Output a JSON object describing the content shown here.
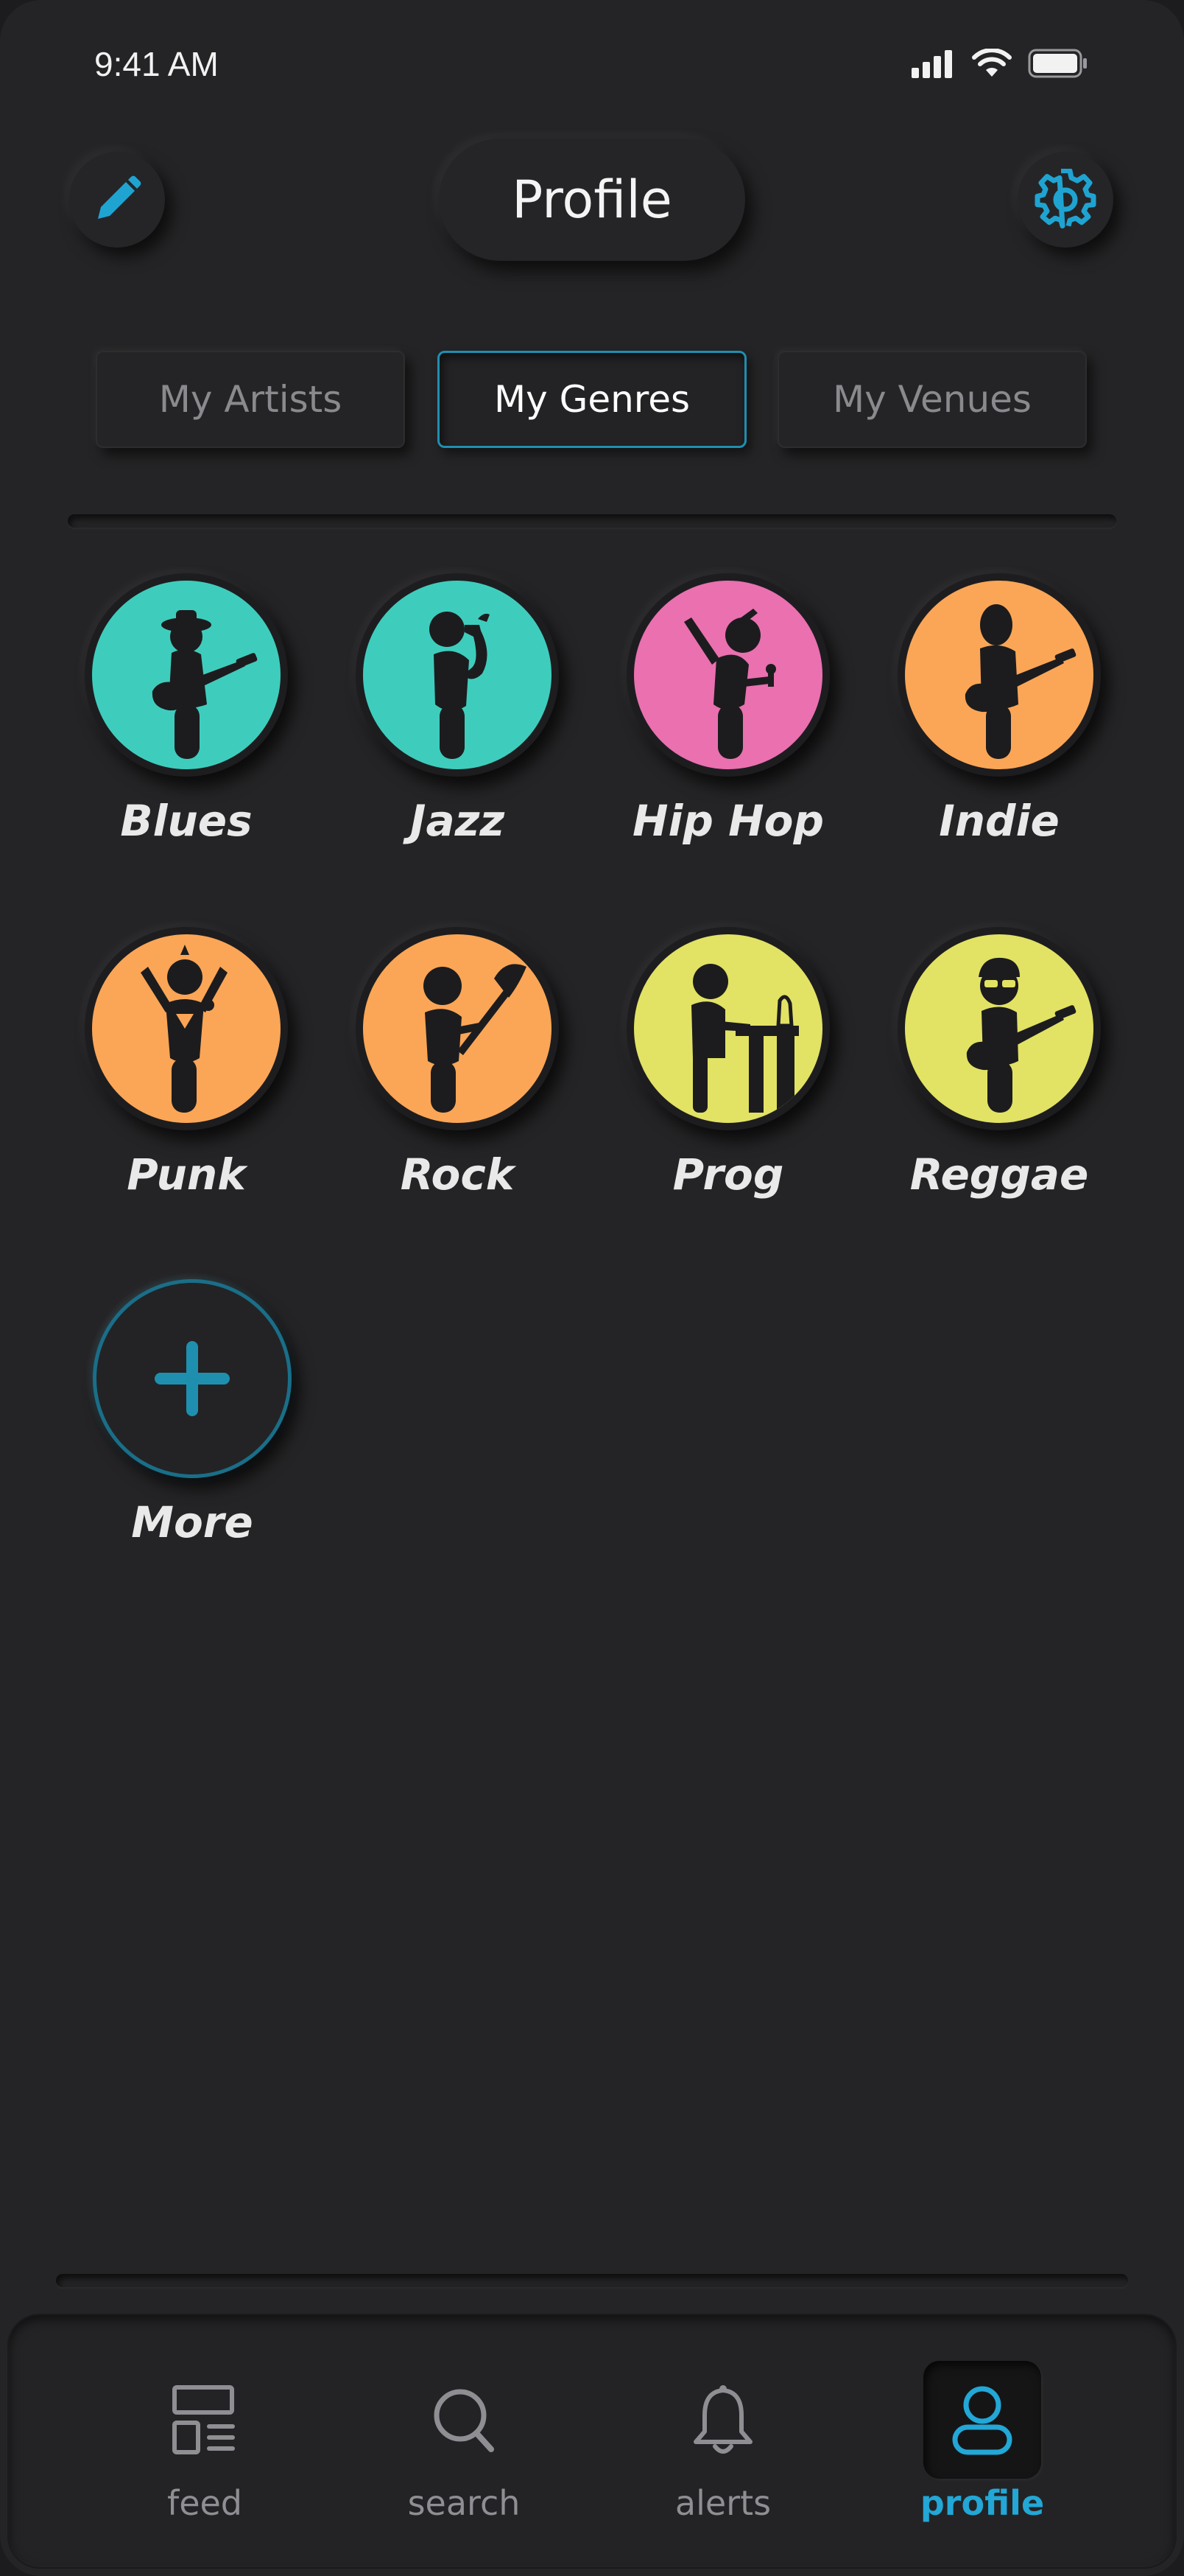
{
  "status_bar": {
    "time": "9:41 AM"
  },
  "header": {
    "title": "Profile",
    "edit_icon": "pencil-icon",
    "settings_icon": "gear-icon"
  },
  "tabs": [
    {
      "label": "My Artists",
      "active": false
    },
    {
      "label": "My Genres",
      "active": true
    },
    {
      "label": "My Venues",
      "active": false
    }
  ],
  "genres": [
    {
      "label": "Blues",
      "color": "#3ecdbd",
      "icon": "guitarist-hat-icon"
    },
    {
      "label": "Jazz",
      "color": "#3ecdbd",
      "icon": "saxophonist-icon"
    },
    {
      "label": "Hip Hop",
      "color": "#ea70b0",
      "icon": "rapper-icon"
    },
    {
      "label": "Indie",
      "color": "#fba656",
      "icon": "guitarist-icon"
    },
    {
      "label": "Punk",
      "color": "#fba656",
      "icon": "punk-singer-icon"
    },
    {
      "label": "Rock",
      "color": "#fba656",
      "icon": "rock-guitarist-icon"
    },
    {
      "label": "Prog",
      "color": "#e2e265",
      "icon": "keyboardist-icon"
    },
    {
      "label": "Reggae",
      "color": "#e2e265",
      "icon": "reggae-guitarist-icon"
    }
  ],
  "more": {
    "label": "More",
    "icon": "plus-icon"
  },
  "bottom_nav": [
    {
      "label": "feed",
      "icon": "feed-icon",
      "active": false
    },
    {
      "label": "search",
      "icon": "search-icon",
      "active": false
    },
    {
      "label": "alerts",
      "icon": "bell-icon",
      "active": false
    },
    {
      "label": "profile",
      "icon": "profile-icon",
      "active": true
    }
  ],
  "colors": {
    "accent": "#22a7d6",
    "background": "#242426",
    "teal": "#3ecdbd",
    "pink": "#ea70b0",
    "orange": "#fba656",
    "yellow": "#e2e265"
  }
}
